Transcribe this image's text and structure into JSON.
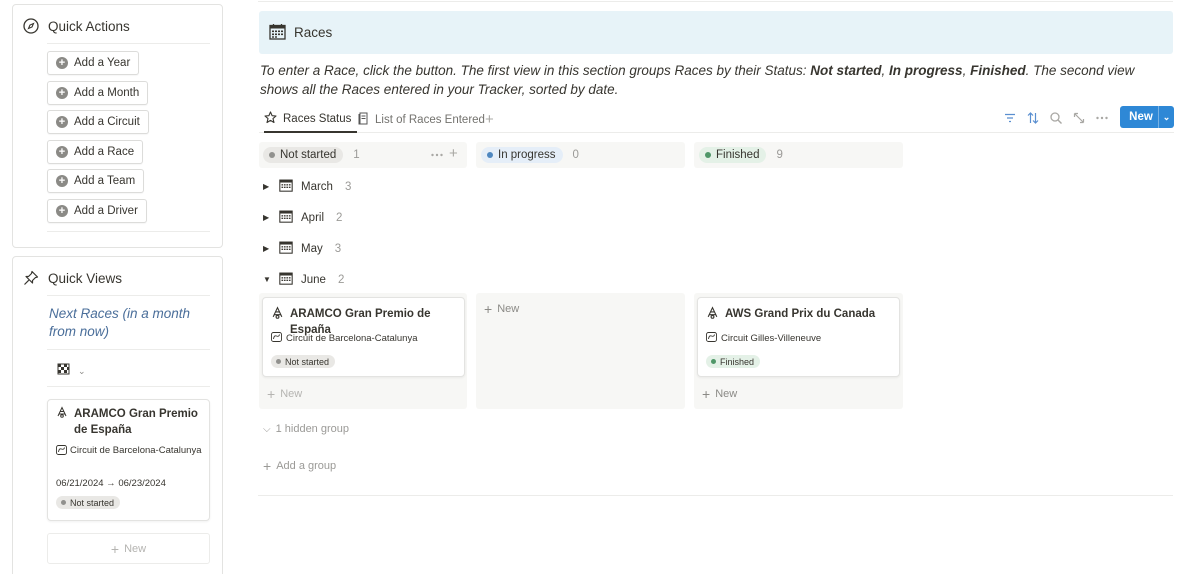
{
  "quick_actions": {
    "title": "Quick Actions",
    "buttons": [
      "Add a Year",
      "Add a Month",
      "Add a Circuit",
      "Add a Race",
      "Add a Team",
      "Add a Driver"
    ]
  },
  "quick_views": {
    "title": "Quick Views",
    "link": "Next Races (in a month from now)",
    "card": {
      "title": "ARAMCO Gran Premio de España",
      "circuit": "Circuit de Barcelona-Catalunya",
      "dates": "06/21/2024 → 06/23/2024",
      "status": "Not started"
    },
    "new_label": "New"
  },
  "banner": {
    "title": "Races"
  },
  "description": {
    "part1": "To enter a Race, click the button. The first view in this section groups Races by their Status: ",
    "s1": "Not started",
    "sep1": ", ",
    "s2": "In progress",
    "sep2": ", ",
    "s3": "Finished",
    "part2": ". The second view shows all the Races entered in your Tracker, sorted by date."
  },
  "tabs": [
    {
      "label": "Races Status",
      "icon": "star-icon"
    },
    {
      "label": "List of Races Entered",
      "icon": "document-icon"
    }
  ],
  "toolbar": {
    "new_label": "New"
  },
  "board": {
    "columns": [
      {
        "status": "Not started",
        "count": "1"
      },
      {
        "status": "In progress",
        "count": "0"
      },
      {
        "status": "Finished",
        "count": "9"
      }
    ],
    "months": [
      {
        "name": "March",
        "count": "3",
        "expanded": false
      },
      {
        "name": "April",
        "count": "2",
        "expanded": false
      },
      {
        "name": "May",
        "count": "3",
        "expanded": false
      },
      {
        "name": "June",
        "count": "2",
        "expanded": true
      }
    ],
    "cards": [
      {
        "title": "ARAMCO Gran Premio de España",
        "circuit": "Circuit de Barcelona-Catalunya",
        "status": "Not started"
      },
      {
        "title": "AWS Grand Prix du Canada",
        "circuit": "Circuit Gilles-Villeneuve",
        "status": "Finished"
      }
    ],
    "new_label": "New",
    "hidden_group": "1 hidden group",
    "add_group": "Add a group"
  },
  "colors": {
    "banner_bg": "#e7f3f8",
    "accent": "#2e88d6",
    "link": "#4a6e9a",
    "not_started": "#91918e",
    "in_progress": "#4e87c0",
    "finished": "#4f9768"
  }
}
